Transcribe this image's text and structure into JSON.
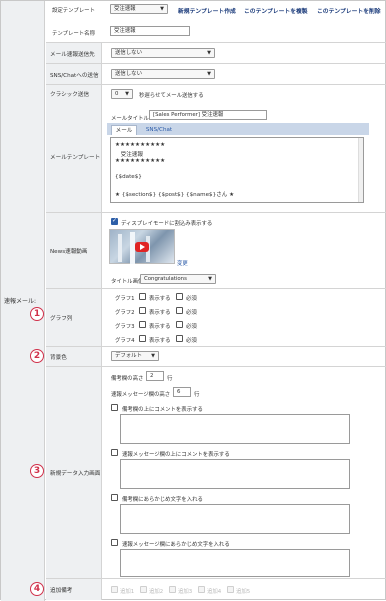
{
  "section_label": "速報メール:",
  "template": {
    "label": "設定テンプレート",
    "selected": "受注速報",
    "new_link": "新規テンプレート作成",
    "copy_link": "このテンプレートを複製",
    "delete_link": "このテンプレートを削除",
    "name_label": "テンプレート名称",
    "name_value": "受注速報"
  },
  "mail_to": {
    "label": "メール速報送信先",
    "value": "送信しない"
  },
  "sns": {
    "label": "SNS/Chatへの送信",
    "value": "送信しない"
  },
  "classic": {
    "label": "クラシック送信",
    "value": "0",
    "note": "秒遅らせてメール送信する"
  },
  "mail_template": {
    "label": "メールテンプレート",
    "title_label": "メールタイトル",
    "title_value": "[Sales Performer] 受注速報",
    "tab_mail": "メール",
    "tab_sns": "SNS/Chat",
    "body_lines": [
      "★★★★★★★★★★",
      "　受注速報",
      "★★★★★★★★★★",
      "",
      "{$date$}",
      "",
      "★ {$section$} {$post$} {$name$}さん ★"
    ]
  },
  "news_video": {
    "label": "News速報動画",
    "display_mode_checkbox": "ディスプレイモードに割込み表示する",
    "change_link": "変更",
    "title_image_label": "タイトル画像",
    "title_image_value": "Congratulations"
  },
  "graph_list": {
    "label": "グラフ列",
    "badge": "1",
    "rows": [
      {
        "name": "グラフ1",
        "show": "表示する",
        "required": "必須"
      },
      {
        "name": "グラフ2",
        "show": "表示する",
        "required": "必須"
      },
      {
        "name": "グラフ3",
        "show": "表示する",
        "required": "必須"
      },
      {
        "name": "グラフ4",
        "show": "表示する",
        "required": "必須"
      }
    ]
  },
  "bg_color": {
    "label": "背景色",
    "badge": "2",
    "value": "デフォルト"
  },
  "new_data": {
    "label": "新規データ入力画面",
    "badge": "3",
    "remarks_height_label": "備考欄の高さ",
    "remarks_height_value": "2",
    "remarks_height_unit": "行",
    "msg_height_label": "速報メッセージ欄の高さ",
    "msg_height_value": "6",
    "msg_height_unit": "行",
    "cb1": "備考欄の上にコメントを表示する",
    "cb2": "速報メッセージ欄の上にコメントを表示する",
    "cb3": "備考欄にあらかじめ文字を入れる",
    "cb4": "速報メッセージ欄にあらかじめ文字を入れる"
  },
  "extra_remarks": {
    "label": "追加備考",
    "badge": "4",
    "items": [
      "追加1",
      "追加2",
      "追加3",
      "追加4",
      "追加5"
    ]
  },
  "colors": {
    "accent": "#2e5fa8",
    "badge": "#d0304a",
    "label_bg": "#eef0f2"
  }
}
